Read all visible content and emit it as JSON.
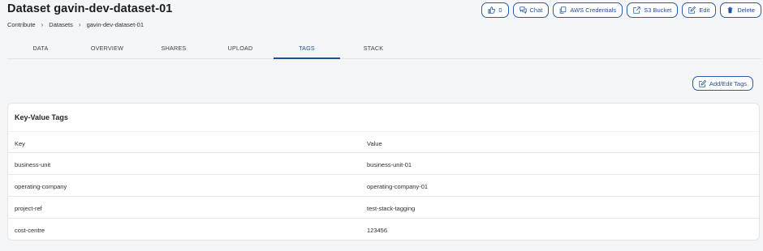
{
  "header": {
    "title": "Dataset gavin-dev-dataset-01",
    "breadcrumb": [
      "Contribute",
      "Datasets",
      "gavin-dev-dataset-01"
    ]
  },
  "actions": {
    "like_count": "0",
    "chat": "Chat",
    "aws_credentials": "AWS Credentials",
    "s3_bucket": "S3 Bucket",
    "edit": "Edit",
    "delete": "Delete"
  },
  "tabs": [
    {
      "label": "DATA",
      "active": false
    },
    {
      "label": "OVERVIEW",
      "active": false
    },
    {
      "label": "SHARES",
      "active": false
    },
    {
      "label": "UPLOAD",
      "active": false
    },
    {
      "label": "TAGS",
      "active": true
    },
    {
      "label": "STACK",
      "active": false
    }
  ],
  "add_edit_tags": "Add/Edit Tags",
  "tags_card": {
    "title": "Key-Value Tags",
    "columns": {
      "key": "Key",
      "value": "Value"
    },
    "rows": [
      {
        "key": "business-unit",
        "value": "business-unit-01"
      },
      {
        "key": "operating-company",
        "value": "operating-company-01"
      },
      {
        "key": "project-ref",
        "value": "test-stack-tagging"
      },
      {
        "key": "cost-centre",
        "value": "123456"
      }
    ]
  },
  "colors": {
    "accent": "#1d4f9c",
    "background": "#f4f5f7"
  }
}
